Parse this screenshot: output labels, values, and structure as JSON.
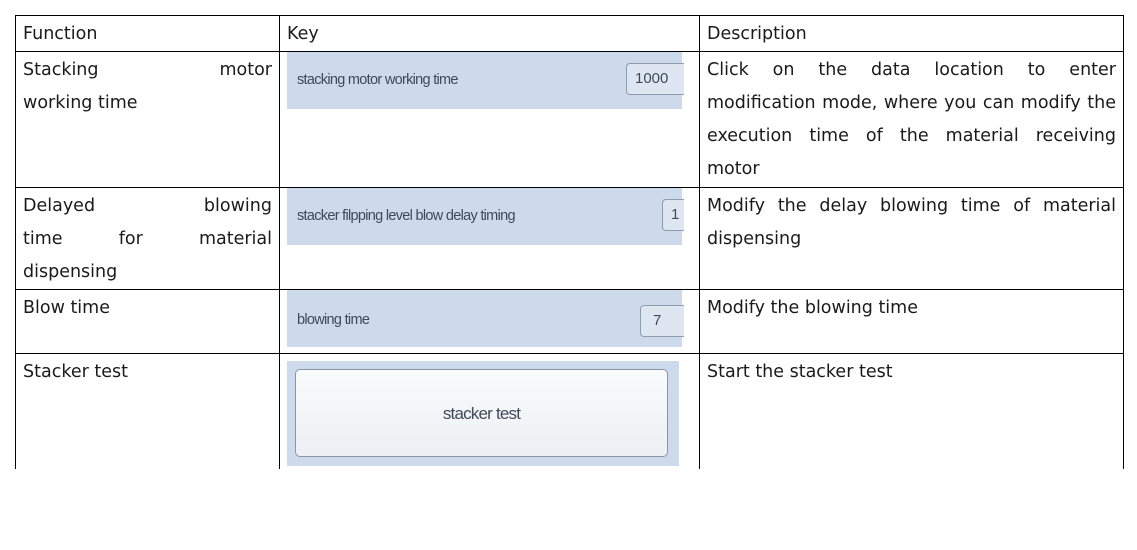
{
  "table": {
    "headers": {
      "function": "Function",
      "key": "Key",
      "description": "Description"
    },
    "rows": [
      {
        "function_lines": [
          "Stacking motor",
          "working time"
        ],
        "key": {
          "type": "field",
          "label": "stacking motor working time",
          "value": "1000"
        },
        "description": "Click on the data location to enter modification mode, where you can modify the execution time of the material receiving motor"
      },
      {
        "function_lines": [
          "Delayed blowing",
          "time for material",
          "dispensing"
        ],
        "key": {
          "type": "field",
          "label": "stacker filpping level blow delay timing",
          "value": "1"
        },
        "description": "Modify the delay blowing time of material dispensing"
      },
      {
        "function_lines": [
          "Blow time"
        ],
        "key": {
          "type": "field",
          "label": "blowing time",
          "value": "7"
        },
        "description": "Modify the blowing time"
      },
      {
        "function_lines": [
          "Stacker test"
        ],
        "key": {
          "type": "button",
          "label": "stacker test"
        },
        "description": "Start the stacker test"
      }
    ]
  }
}
